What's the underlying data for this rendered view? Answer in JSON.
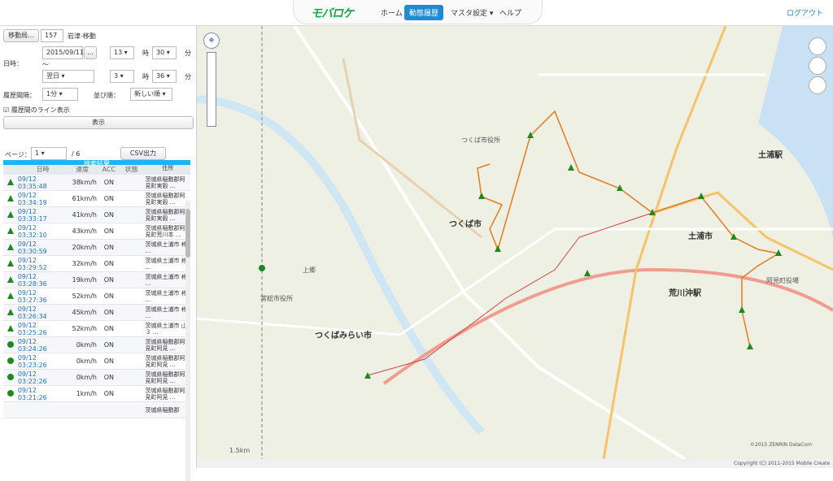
{
  "header": {
    "logo_text": "モバロケ",
    "menu": [
      "ホーム",
      "動態履歴",
      "マスタ設定",
      "ヘルプ"
    ],
    "active_menu": "動態履歴",
    "logout": "ログアウト"
  },
  "form": {
    "vehicle_button": "移動局...",
    "vehicle_id": "157",
    "vehicle_name": "岩津-移動",
    "datetime_label": "日時：",
    "start_date": "2015/09/11",
    "start_hour": "13",
    "start_minute": "30",
    "hour_unit": "時",
    "minute_unit": "分",
    "tilde": "〜",
    "end_date": "翌日",
    "end_hour": "3",
    "end_minute": "36",
    "interval_label": "履歴間隔：",
    "interval_value": "1分",
    "order_label": "並び順：",
    "order_value": "新しい順",
    "line_checkbox_label": "履歴間のライン表示",
    "show_button": "表示"
  },
  "results": {
    "title": "検索結果",
    "page_label": "ページ：",
    "page_value": "1",
    "page_total": "/ 6",
    "csv_button": "CSV出力",
    "columns": [
      "日時",
      "速度",
      "ACC",
      "状態",
      "住所"
    ],
    "rows": [
      {
        "time": "09/12 03:35:48",
        "speed": "38km/h",
        "acc": "ON",
        "addr": "茨城県稲敷郡阿見町実穀 ..."
      },
      {
        "time": "09/12 03:34:19",
        "speed": "61km/h",
        "acc": "ON",
        "addr": "茨城県稲敷郡阿見町実穀 ..."
      },
      {
        "time": "09/12 03:33:17",
        "speed": "41km/h",
        "acc": "ON",
        "addr": "茨城県稲敷郡阿見町実穀 ..."
      },
      {
        "time": "09/12 03:32:10",
        "speed": "43km/h",
        "acc": "ON",
        "addr": "茨城県稲敷郡阿見町荒川本 ..."
      },
      {
        "time": "09/12 03:30:59",
        "speed": "20km/h",
        "acc": "ON",
        "addr": "茨城県土浦市 柊 ..."
      },
      {
        "time": "09/12 03:29:52",
        "speed": "32km/h",
        "acc": "ON",
        "addr": "茨城県土浦市 柊 ..."
      },
      {
        "time": "09/12 03:28:36",
        "speed": "19km/h",
        "acc": "ON",
        "addr": "茨城県土浦市 柊 ..."
      },
      {
        "time": "09/12 03:27:36",
        "speed": "52km/h",
        "acc": "ON",
        "addr": "茨城県土浦市 柊 ..."
      },
      {
        "time": "09/12 03:26:34",
        "speed": "45km/h",
        "acc": "ON",
        "addr": "茨城県土浦市 柊 ..."
      },
      {
        "time": "09/12 03:25:26",
        "speed": "52km/h",
        "acc": "ON",
        "addr": "茨城県土浦市 山３ ..."
      },
      {
        "time": "09/12 03:24:26",
        "speed": "0km/h",
        "acc": "ON",
        "addr": "茨城県稲敷郡阿見町阿見 ..."
      },
      {
        "time": "09/12 03:23:26",
        "speed": "0km/h",
        "acc": "ON",
        "addr": "茨城県稲敷郡阿見町阿見 ..."
      },
      {
        "time": "09/12 03:22:26",
        "speed": "0km/h",
        "acc": "ON",
        "addr": "茨城県稲敷郡阿見町阿見 ..."
      },
      {
        "time": "09/12 03:21:26",
        "speed": "1km/h",
        "acc": "ON",
        "addr": "茨城県稲敷郡阿見町阿見 ..."
      },
      {
        "time": "",
        "speed": "",
        "acc": "",
        "addr": "茨城県稲敷郡"
      }
    ]
  },
  "map": {
    "labels": {
      "tsukuba": "つくば市",
      "tsukubamirai": "つくばみらい市",
      "tsuchiura": "土浦市",
      "arakawaoki": "荒川沖駅",
      "tsuchiura_station": "土浦駅",
      "ami": "阿見町役場",
      "kamigo": "上郷",
      "kenkyugakuen": "つくば市役所",
      "joso": "常総市役所"
    },
    "scale": "1.5km",
    "copyright_map": "©2015 ZENRIN DataCom",
    "copyright_app": "Copyright (C) 2011-2015 Mobile Create"
  }
}
